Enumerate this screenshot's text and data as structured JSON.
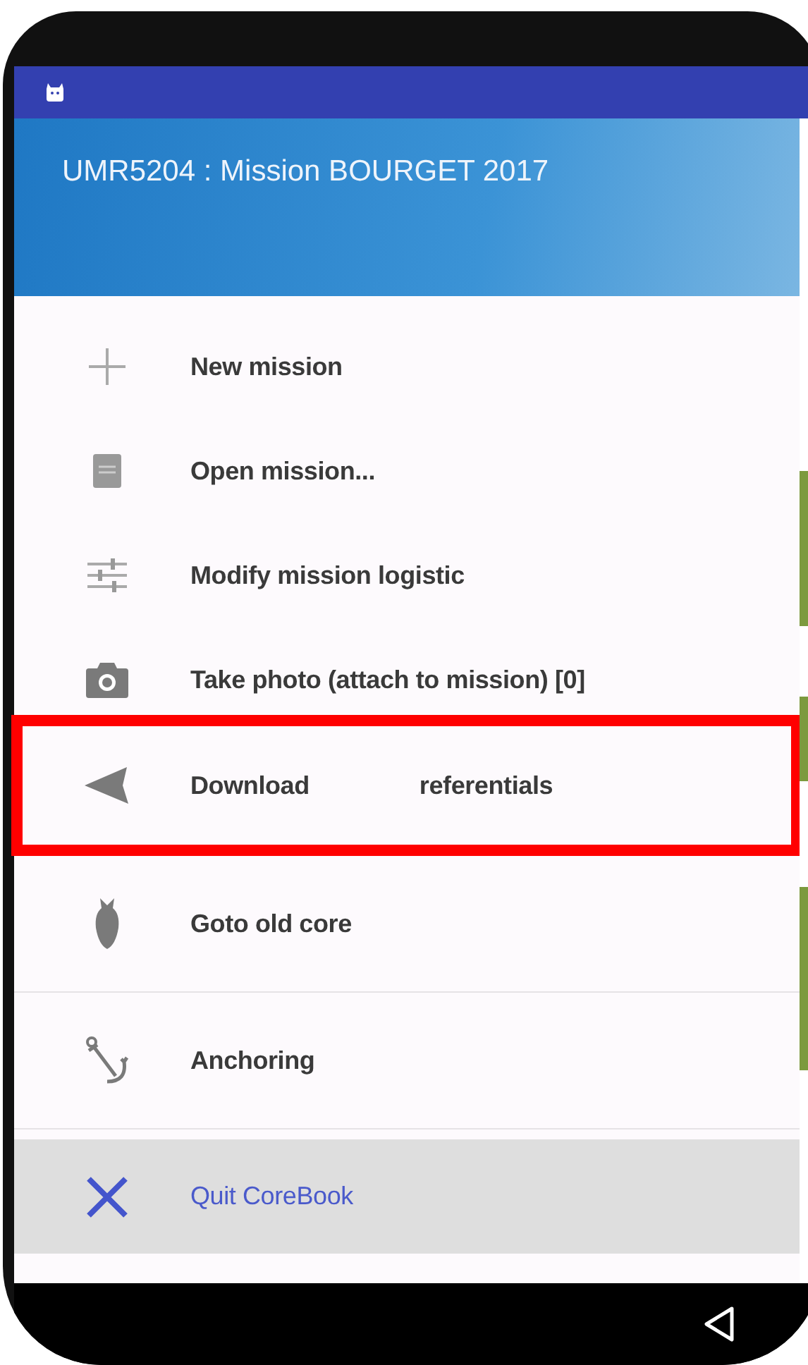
{
  "header": {
    "subtitle": "UMR5204 : Mission BOURGET 2017"
  },
  "menu": {
    "items": [
      {
        "label": "New mission",
        "selected": false,
        "highlighted": false,
        "divider_after": false
      },
      {
        "label": "Open mission...",
        "selected": false,
        "highlighted": false,
        "divider_after": false
      },
      {
        "label": "Modify mission logistic",
        "selected": false,
        "highlighted": false,
        "divider_after": false
      },
      {
        "label": "Take photo (attach to mission) [0]",
        "selected": false,
        "highlighted": false,
        "divider_after": false
      },
      {
        "label": "Download",
        "label_after": "referentials",
        "selected": false,
        "highlighted": true,
        "divider_after": false
      },
      {
        "label": "Goto old core",
        "selected": false,
        "highlighted": false,
        "divider_after": true
      },
      {
        "label": "Anchoring",
        "selected": false,
        "highlighted": false,
        "divider_after": true
      },
      {
        "label": "Quit CoreBook",
        "selected": true,
        "highlighted": false,
        "divider_after": false
      }
    ]
  }
}
